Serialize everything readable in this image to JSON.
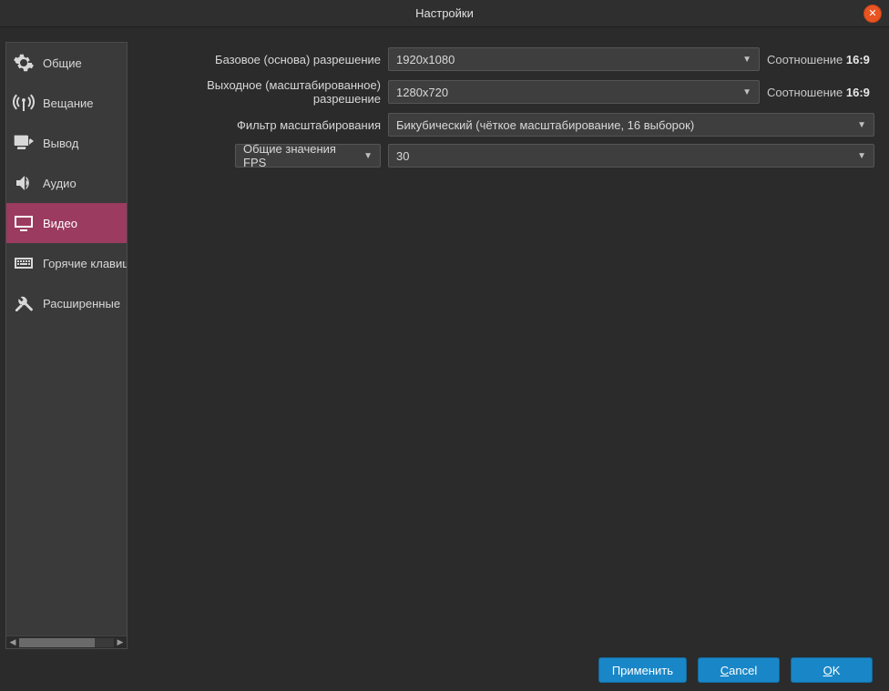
{
  "title": "Настройки",
  "sidebar": {
    "items": [
      {
        "label": "Общие"
      },
      {
        "label": "Вещание"
      },
      {
        "label": "Вывод"
      },
      {
        "label": "Аудио"
      },
      {
        "label": "Видео"
      },
      {
        "label": "Горячие клавиши"
      },
      {
        "label": "Расширенные"
      }
    ]
  },
  "form": {
    "base_res_label": "Базовое (основа) разрешение",
    "base_res_value": "1920x1080",
    "output_res_label": "Выходное (масштабированное) разрешение",
    "output_res_value": "1280x720",
    "aspect_label": "Соотношение",
    "aspect_base": "16:9",
    "aspect_output": "16:9",
    "filter_label": "Фильтр масштабирования",
    "filter_value": "Бикубический (чёткое масштабирование, 16 выборок)",
    "fps_mode_label": "Общие значения FPS",
    "fps_value": "30"
  },
  "buttons": {
    "apply": "Применить",
    "cancel": "Cancel",
    "ok": "OK"
  }
}
